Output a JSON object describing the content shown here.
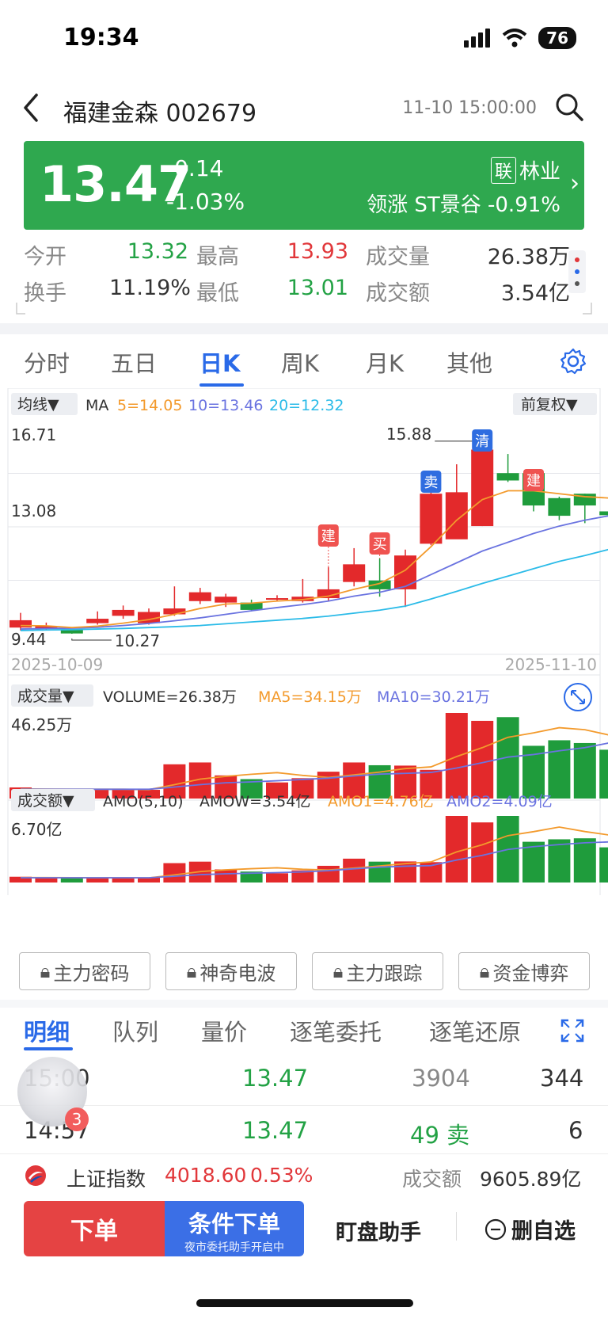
{
  "status": {
    "time": "19:34",
    "battery": "76"
  },
  "header": {
    "title": "福建金森 002679",
    "datetime": "11-10 15:00:00"
  },
  "quote": {
    "price": "13.47",
    "change": "-0.14",
    "change_pct": "-1.03%",
    "sector_tag": "联",
    "sector": "林业",
    "leader": "领涨 ST景谷 -0.91%",
    "panel_color": "#2fa84f"
  },
  "stats": [
    {
      "label": "今开",
      "value": "13.32",
      "color": "green"
    },
    {
      "label": "最高",
      "value": "13.93",
      "color": "red"
    },
    {
      "label": "成交量",
      "value": "26.38万",
      "color": "dark"
    },
    {
      "label": "换手",
      "value": "11.19%",
      "color": "dark"
    },
    {
      "label": "最低",
      "value": "13.01",
      "color": "green"
    },
    {
      "label": "成交额",
      "value": "3.54亿",
      "color": "dark"
    }
  ],
  "tabs": [
    "分时",
    "五日",
    "日K",
    "周K",
    "月K",
    "其他"
  ],
  "active_tab": "日K",
  "kline": {
    "ma_selector": "均线▼",
    "ma_prefix": "MA",
    "ma5": "5=14.05",
    "ma10": "10=13.46",
    "ma20": "20=12.32",
    "adjust": "前复权▼",
    "y_top": "16.71",
    "y_mid": "13.08",
    "y_bottom": "9.44",
    "high_label": "15.88",
    "low_label": "10.27",
    "date_start": "2025-10-09",
    "date_end": "2025-11-10",
    "signals": [
      "建",
      "买",
      "卖",
      "清",
      "建"
    ]
  },
  "volume": {
    "selector": "成交量▼",
    "volume_label": "VOLUME=26.38万",
    "ma5_label": "MA5=34.15万",
    "ma10_label": "MA10=30.21万",
    "y_top": "46.25万"
  },
  "amount": {
    "selector": "成交额▼",
    "param_label": "AMO(5,10)",
    "amow_label": "AMOW=3.54亿",
    "amo1_label": "AMO1=4.76亿",
    "amo2_label": "AMO2=4.09亿",
    "y_top": "6.70亿"
  },
  "chart_data": {
    "type": "candlestick",
    "x": [
      "2025-10-09",
      "",
      "",
      "",
      "",
      "",
      "",
      "",
      "",
      "",
      "",
      "",
      "",
      "",
      "",
      "",
      "",
      "",
      "",
      "",
      "",
      "",
      "",
      "2025-11-10"
    ],
    "open": [
      9.65,
      9.62,
      9.58,
      9.8,
      10.05,
      9.8,
      10.1,
      10.55,
      10.5,
      10.5,
      10.6,
      10.55,
      10.65,
      11.2,
      11.25,
      10.95,
      12.5,
      12.65,
      13.1,
      14.9,
      14.9,
      14.05,
      14.2,
      13.6
    ],
    "close": [
      9.9,
      9.7,
      9.45,
      9.95,
      10.25,
      10.18,
      10.3,
      10.85,
      10.7,
      10.25,
      10.65,
      10.7,
      10.95,
      11.8,
      10.95,
      12.1,
      14.2,
      14.25,
      15.7,
      14.65,
      13.8,
      13.45,
      13.8,
      13.47
    ],
    "high": [
      10.15,
      9.82,
      9.58,
      10.2,
      10.4,
      10.3,
      11.05,
      11.0,
      10.8,
      10.6,
      10.75,
      11.3,
      11.7,
      12.35,
      12.0,
      12.3,
      14.45,
      15.2,
      15.88,
      15.55,
      14.9,
      14.1,
      14.2,
      14.35
    ],
    "low": [
      9.55,
      9.55,
      9.44,
      9.75,
      9.95,
      9.75,
      10.05,
      10.45,
      10.35,
      10.2,
      10.55,
      10.5,
      10.55,
      11.05,
      10.7,
      10.35,
      12.45,
      13.6,
      13.1,
      14.6,
      13.6,
      13.3,
      13.2,
      13.25
    ],
    "ma5": [
      9.72,
      9.71,
      9.65,
      9.7,
      9.8,
      9.92,
      10.1,
      10.3,
      10.45,
      10.48,
      10.55,
      10.6,
      10.72,
      10.95,
      11.15,
      11.6,
      12.4,
      13.3,
      14.0,
      14.3,
      14.3,
      14.2,
      14.1,
      14.05
    ],
    "ma10": [
      9.6,
      9.62,
      9.63,
      9.66,
      9.72,
      9.79,
      9.88,
      9.98,
      10.1,
      10.22,
      10.33,
      10.43,
      10.55,
      10.72,
      10.85,
      11.05,
      11.45,
      11.85,
      12.25,
      12.55,
      12.85,
      13.1,
      13.3,
      13.46
    ],
    "ma20": [
      9.55,
      9.57,
      9.58,
      9.6,
      9.62,
      9.65,
      9.68,
      9.72,
      9.78,
      9.84,
      9.9,
      9.96,
      10.04,
      10.14,
      10.24,
      10.38,
      10.62,
      10.88,
      11.15,
      11.4,
      11.65,
      11.9,
      12.1,
      12.32
    ],
    "volume": [
      6.0,
      4.8,
      4.6,
      4.8,
      4.7,
      4.7,
      18.5,
      19.5,
      12.5,
      10.5,
      8.7,
      11.0,
      14.5,
      19.5,
      18.0,
      17.8,
      15.5,
      46.25,
      42.0,
      44.0,
      28.5,
      31.5,
      30.0,
      26.38
    ],
    "vol_ma5": [
      5.2,
      5.1,
      5.0,
      5.0,
      5.0,
      4.8,
      7.5,
      10.5,
      12.0,
      13.1,
      14.0,
      12.5,
      11.4,
      12.8,
      14.3,
      16.2,
      17.1,
      22.7,
      27.5,
      33.1,
      35.5,
      38.3,
      37.2,
      34.15
    ],
    "vol_ma10": [
      5.0,
      5.0,
      5.0,
      5.0,
      5.0,
      5.0,
      6.2,
      7.5,
      8.5,
      9.0,
      9.6,
      10.3,
      11.0,
      12.2,
      13.2,
      13.6,
      14.1,
      16.5,
      19.4,
      22.4,
      23.8,
      25.8,
      27.5,
      30.21
    ],
    "amount": [
      0.58,
      0.47,
      0.44,
      0.47,
      0.48,
      0.48,
      1.95,
      2.1,
      1.32,
      1.1,
      0.93,
      1.22,
      1.68,
      2.4,
      2.1,
      2.12,
      2.05,
      6.7,
      6.05,
      6.7,
      4.1,
      4.35,
      4.45,
      3.54
    ],
    "amo1": [
      0.5,
      0.5,
      0.49,
      0.48,
      0.48,
      0.47,
      0.77,
      1.1,
      1.27,
      1.39,
      1.48,
      1.33,
      1.25,
      1.45,
      1.66,
      1.9,
      2.07,
      3.08,
      3.8,
      4.72,
      5.12,
      5.58,
      5.13,
      4.76
    ],
    "amo2": [
      0.48,
      0.48,
      0.48,
      0.48,
      0.48,
      0.48,
      0.63,
      0.79,
      0.88,
      0.94,
      1.0,
      1.07,
      1.19,
      1.38,
      1.55,
      1.64,
      1.7,
      2.26,
      2.73,
      3.33,
      3.61,
      3.82,
      4.0,
      4.09
    ],
    "ylim": [
      9.44,
      16.71
    ],
    "volume_max": 46.25,
    "amount_max": 6.7,
    "colors": {
      "up": "#e3292b",
      "down": "#1f9c3c",
      "ma5": "#f39a2c",
      "ma10": "#6a73e0",
      "ma20": "#2bbbe8"
    }
  },
  "locked_buttons": [
    "主力密码",
    "神奇电波",
    "主力跟踪",
    "资金博弈"
  ],
  "detail_tabs": [
    "明细",
    "队列",
    "量价",
    "逐笔委托",
    "逐笔还原"
  ],
  "trades": [
    {
      "time": "15:00",
      "price": "13.47",
      "volume": "3904",
      "count": "344",
      "vol_color": "gray"
    },
    {
      "time": "14:57",
      "price": "13.47",
      "volume": "49 卖",
      "count": "6",
      "vol_color": "green"
    }
  ],
  "avatar_badge": "3",
  "index_bar": {
    "name": "上证指数",
    "value": "4018.60",
    "pct": "0.53%",
    "amount_label": "成交额",
    "amount": "9605.89亿"
  },
  "bottom": {
    "order": "下单",
    "conditional": "条件下单",
    "conditional_sub": "夜市委托助手开启中",
    "watch": "盯盘助手",
    "remove": "删自选"
  }
}
